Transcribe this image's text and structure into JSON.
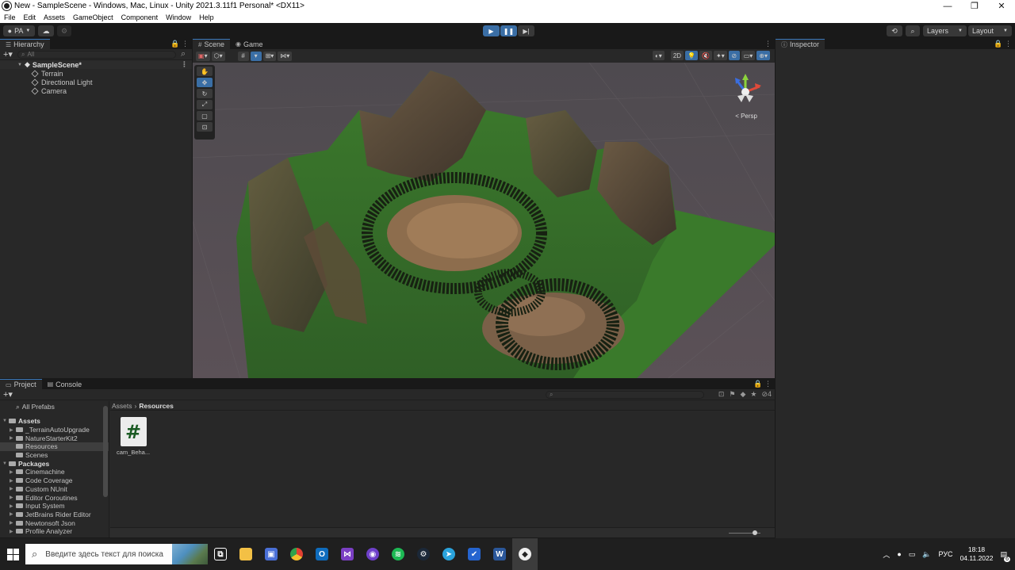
{
  "window": {
    "title": "New - SampleScene - Windows, Mac, Linux - Unity 2021.3.11f1 Personal* <DX11>",
    "minimize_glyph": "—",
    "maximize_glyph": "❐",
    "close_glyph": "✕"
  },
  "menu": [
    "File",
    "Edit",
    "Assets",
    "GameObject",
    "Component",
    "Window",
    "Help"
  ],
  "toolbar": {
    "account": "PA",
    "layers": "Layers",
    "layout": "Layout"
  },
  "hierarchy": {
    "tab": "Hierarchy",
    "search_placeholder": "All",
    "scene": "SampleScene*",
    "items": [
      "Terrain",
      "Directional Light",
      "Camera"
    ]
  },
  "scene_view": {
    "tabs": [
      "Scene",
      "Game"
    ],
    "mode_2d": "2D",
    "projection": "Persp"
  },
  "inspector": {
    "tab": "Inspector"
  },
  "project": {
    "tabs": [
      "Project",
      "Console"
    ],
    "all_prefabs": "All Prefabs",
    "assets_label": "Assets",
    "asset_folders": [
      "_TerrainAutoUpgrade",
      "NatureStarterKit2",
      "Resources",
      "Scenes"
    ],
    "packages_label": "Packages",
    "packages": [
      "Cinemachine",
      "Code Coverage",
      "Custom NUnit",
      "Editor Coroutines",
      "Input System",
      "JetBrains Rider Editor",
      "Newtonsoft Json",
      "Profile Analyzer"
    ],
    "breadcrumb": [
      "Assets",
      "Resources"
    ],
    "files": [
      {
        "name": "cam_Beha...",
        "icon": "#"
      }
    ],
    "hidden_count": "4"
  },
  "taskbar": {
    "search_placeholder": "Введите здесь текст для поиска",
    "language": "РУС",
    "time": "18:18",
    "date": "04.11.2022",
    "notification_count": "6"
  },
  "colors": {
    "accent": "#3a6ea5",
    "terrain_grass": "#3f7a2e",
    "terrain_rock": "#5a4a38",
    "sky": "#514c50"
  }
}
